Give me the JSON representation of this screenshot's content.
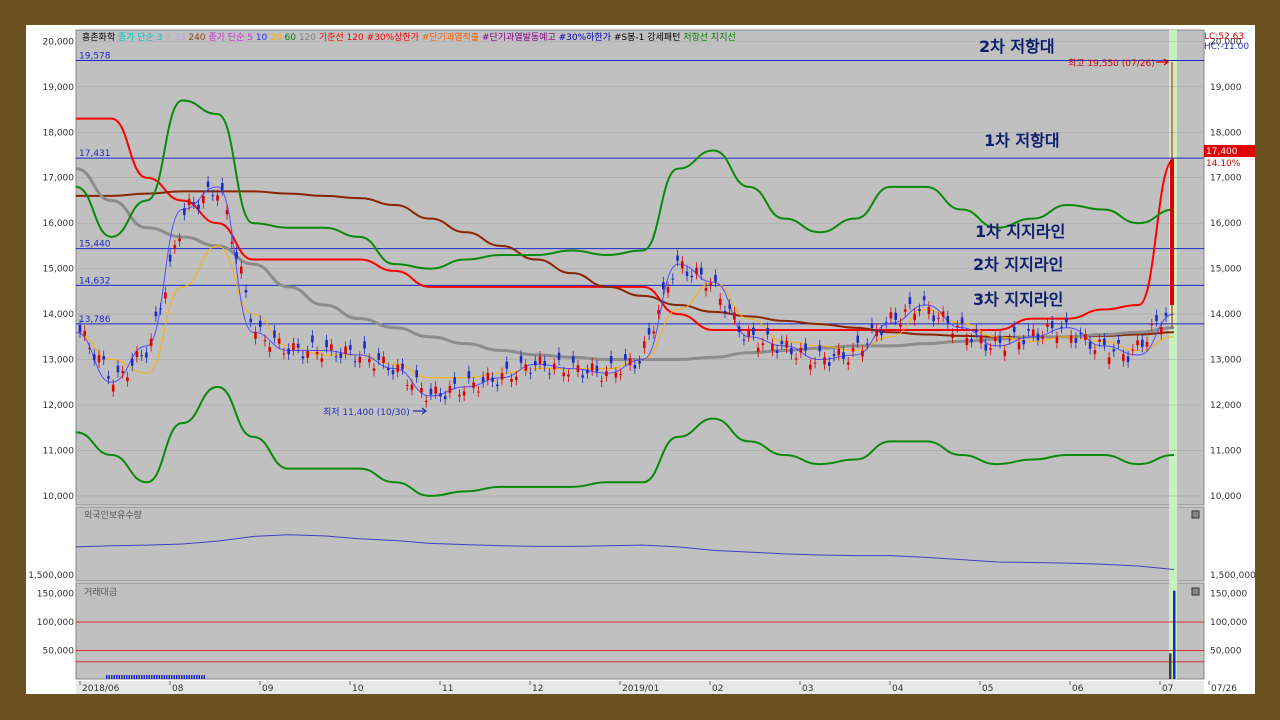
{
  "header": {
    "stock": "흥촌화학",
    "legend": [
      {
        "text": "종가 단순 3",
        "color": "#00c8c8"
      },
      {
        "text": "7",
        "color": "#b0b0b0"
      },
      {
        "text": "33",
        "color": "#c0a0e0"
      },
      {
        "text": "240",
        "color": "#8b4513"
      },
      {
        "text": "종가 단순 5",
        "color": "#d030d0"
      },
      {
        "text": "10",
        "color": "#3030ff"
      },
      {
        "text": "20",
        "color": "#ffb000"
      },
      {
        "text": "60",
        "color": "#008000"
      },
      {
        "text": "120",
        "color": "#808080"
      },
      {
        "text": "기준선 120",
        "color": "#ff0000"
      },
      {
        "text": "#30%상한가",
        "color": "#ff0000"
      },
      {
        "text": "#단기과열적출",
        "color": "#ff6000"
      },
      {
        "text": "#단기과열발동예고",
        "color": "#800080"
      },
      {
        "text": "#30%하한가",
        "color": "#0000c0"
      },
      {
        "text": "#S봉-1 강세패턴",
        "color": "#000000"
      },
      {
        "text": "저항선",
        "color": "#008000"
      },
      {
        "text": "지지선",
        "color": "#008000"
      }
    ],
    "lc": "LC:52.63",
    "hc": "HC:-11.00"
  },
  "annotations": {
    "resistance2": "2차 저항대",
    "resistance1": "1차 저항대",
    "support1": "1차 지지라인",
    "support2": "2차 지지라인",
    "support3": "3차 지지라인",
    "high_label": "최고 19,550 (07/26)",
    "low_label": "최저 11,400 (10/30)",
    "current_price": "17,400",
    "current_change": "14.10%"
  },
  "chart_data": [
    {
      "type": "line",
      "panel": "price",
      "y_axis_ticks": [
        20000,
        19000,
        18000,
        17000,
        16000,
        15000,
        14000,
        13000,
        12000,
        11000,
        10000
      ],
      "y_axis_labels": [
        "20,000",
        "19,000",
        "18,000",
        "17,000",
        "16,000",
        "15,000",
        "14,000",
        "13,000",
        "12,000",
        "11,000",
        "10,000"
      ],
      "ylim": [
        9800,
        20250
      ],
      "horizontal_lines": [
        {
          "value": 19578,
          "label": "19,578"
        },
        {
          "value": 17431,
          "label": "17,431"
        },
        {
          "value": 15440,
          "label": "15,440"
        },
        {
          "value": 14632,
          "label": "14,632"
        },
        {
          "value": 13786,
          "label": "13,786"
        }
      ],
      "x_labels": [
        "2018/06",
        "08",
        "09",
        "10",
        "11",
        "12",
        "2019/01",
        "02",
        "03",
        "04",
        "05",
        "06",
        "07",
        "07/26"
      ],
      "series": [
        {
          "color": "#ff0000",
          "values": [
            18300,
            18300,
            17000,
            16500,
            16000,
            15200,
            15200,
            15200,
            15200,
            14950,
            14600,
            14600,
            14600,
            14600,
            14600,
            14600,
            14600,
            14000,
            13650,
            13650,
            13650,
            13650,
            13650,
            13650,
            13650,
            13650,
            13650,
            13900,
            13900,
            14100,
            14200,
            17400
          ]
        },
        {
          "color": "#8b2500",
          "values": [
            16600,
            16600,
            16650,
            16700,
            16700,
            16700,
            16650,
            16600,
            16550,
            16400,
            16100,
            15800,
            15500,
            15200,
            14900,
            14600,
            14400,
            14200,
            14050,
            13950,
            13850,
            13780,
            13700,
            13600,
            13550,
            13520,
            13500,
            13500,
            13500,
            13520,
            13550,
            13600
          ]
        },
        {
          "color": "#8c8c8c",
          "values": [
            17200,
            16500,
            15900,
            15700,
            15500,
            15100,
            14600,
            14200,
            13900,
            13700,
            13500,
            13350,
            13200,
            13100,
            13050,
            13000,
            13000,
            13000,
            13050,
            13150,
            13200,
            13250,
            13300,
            13300,
            13350,
            13400,
            13450,
            13500,
            13500,
            13550,
            13600,
            13700
          ]
        },
        {
          "color": "#0a8a0a",
          "values": [
            16800,
            15700,
            16500,
            18700,
            18400,
            16000,
            15900,
            15900,
            15700,
            15100,
            15000,
            15200,
            15300,
            15300,
            15400,
            15300,
            15400,
            17200,
            17600,
            16800,
            16100,
            15800,
            16100,
            16800,
            16800,
            16300,
            15900,
            16100,
            16400,
            16300,
            16000,
            16300
          ]
        },
        {
          "color": "#0a8a0a",
          "values": [
            11400,
            10900,
            10300,
            11600,
            12400,
            11300,
            10600,
            10600,
            10600,
            10300,
            10000,
            10100,
            10200,
            10200,
            10200,
            10300,
            10300,
            11300,
            11700,
            11200,
            10900,
            10700,
            10800,
            11200,
            11200,
            10900,
            10700,
            10800,
            10900,
            10900,
            10700,
            10900
          ]
        },
        {
          "color": "#ffb000",
          "values": [
            13600,
            13000,
            12700,
            14600,
            15500,
            14000,
            13300,
            13100,
            13100,
            12900,
            12600,
            12600,
            12700,
            12800,
            12800,
            12800,
            13000,
            14100,
            14700,
            13900,
            13400,
            13300,
            13200,
            13500,
            14100,
            13800,
            13500,
            13400,
            13500,
            13400,
            13200,
            13500
          ]
        },
        {
          "color": "#5050ff",
          "values": [
            13600,
            12500,
            13300,
            16300,
            16800,
            13600,
            13200,
            13200,
            13100,
            12800,
            12200,
            12400,
            12600,
            12900,
            12800,
            12700,
            13000,
            15100,
            14700,
            13500,
            13300,
            13000,
            13100,
            13800,
            14200,
            13700,
            13300,
            13500,
            13700,
            13300,
            13100,
            14000
          ]
        }
      ]
    },
    {
      "type": "line",
      "panel": "foreign_holdings",
      "title": "외국인보유수량",
      "y_axis_labels": [
        "1,500,000"
      ],
      "series": [
        {
          "color": "#4040c0",
          "values": [
            0.55,
            0.53,
            0.52,
            0.5,
            0.45,
            0.37,
            0.34,
            0.36,
            0.41,
            0.44,
            0.49,
            0.51,
            0.53,
            0.54,
            0.54,
            0.53,
            0.52,
            0.55,
            0.61,
            0.64,
            0.67,
            0.69,
            0.7,
            0.7,
            0.73,
            0.77,
            0.81,
            0.82,
            0.83,
            0.85,
            0.88,
            0.94
          ]
        }
      ]
    },
    {
      "type": "bar",
      "panel": "trading_value",
      "title": "거래대금",
      "y_axis_ticks": [
        150000,
        100000,
        50000
      ],
      "y_axis_labels": [
        "150,000",
        "100,000",
        "50,000"
      ],
      "ylim": [
        0,
        165000
      ],
      "reference_lines": [
        100000,
        50000,
        30000
      ],
      "last_bars": [
        45000,
        155000
      ]
    }
  ]
}
